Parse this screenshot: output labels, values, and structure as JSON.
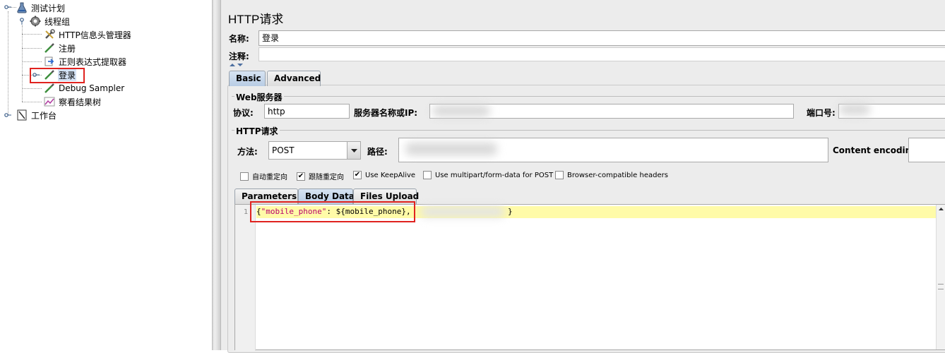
{
  "tree": {
    "root": "测试计划",
    "thread_group": "线程组",
    "items": [
      "HTTP信息头管理器",
      "注册",
      "正则表达式提取器",
      "登录",
      "Debug Sampler",
      "察看结果树"
    ],
    "workbench": "工作台"
  },
  "panel": {
    "title": "HTTP请求",
    "name_label": "名称:",
    "name_value": "登录",
    "comment_label": "注释:",
    "tabs": [
      "Basic",
      "Advanced"
    ],
    "web_server_legend": "Web服务器",
    "protocol_label": "协议:",
    "protocol_value": "http",
    "server_label": "服务器名称或IP:",
    "port_label": "端口号:",
    "http_request_legend": "HTTP请求",
    "method_label": "方法:",
    "method_value": "POST",
    "path_label": "路径:",
    "content_encoding_label": "Content encoding:",
    "checkboxes": [
      {
        "label": "自动重定向",
        "checked": false
      },
      {
        "label": "跟随重定向",
        "checked": true
      },
      {
        "label": "Use KeepAlive",
        "checked": true
      },
      {
        "label": "Use multipart/form-data for POST",
        "checked": false
      },
      {
        "label": "Browser-compatible headers",
        "checked": false
      }
    ],
    "body_tabs": [
      "Parameters",
      "Body Data",
      "Files Upload"
    ],
    "editor": {
      "line_number": "1",
      "open_brace": "{",
      "key": "\"mobile_phone\"",
      "colon": ": ",
      "var_open": "${",
      "var_name": "mobile_phone",
      "var_close": "}",
      "comma": ",",
      "close_brace": "}"
    }
  },
  "colors": {
    "highlight_red": "#e0231f",
    "editor_line_bg": "#fffba8",
    "string_color": "#b8006b",
    "tab_active": "#b8cce4"
  }
}
